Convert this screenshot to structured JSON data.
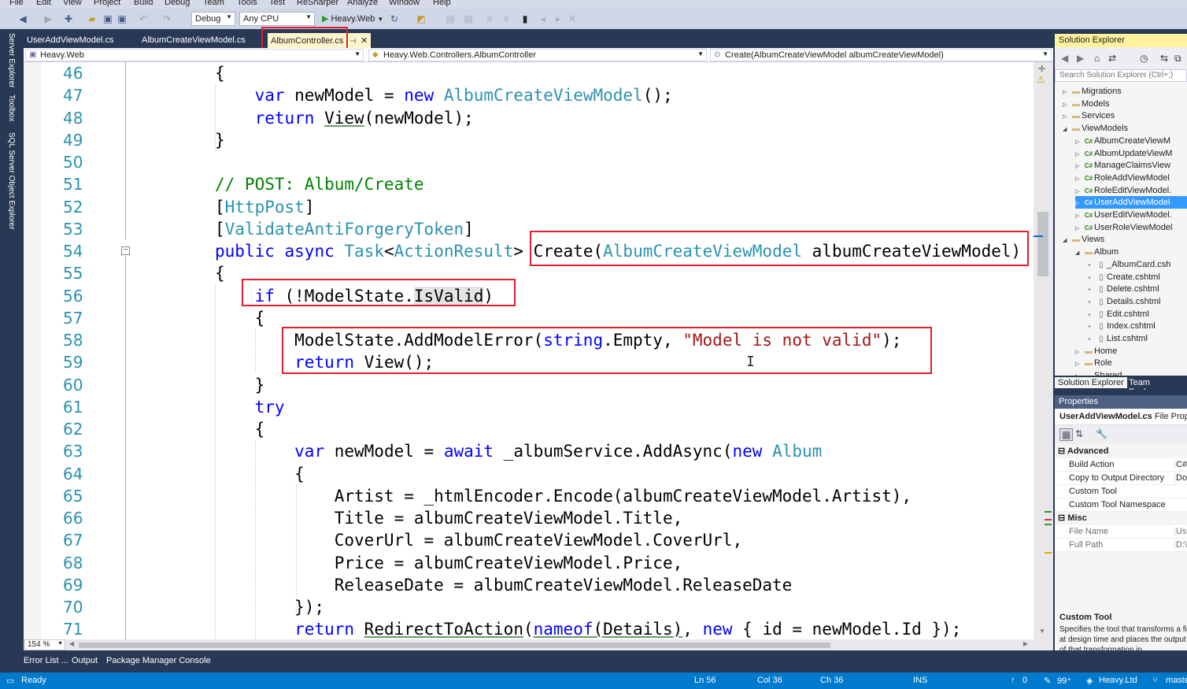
{
  "menu": [
    "File",
    "Edit",
    "View",
    "Project",
    "Build",
    "Debug",
    "Team",
    "Tools",
    "Test",
    "ReSharper",
    "Analyze",
    "Window",
    "Help"
  ],
  "toolbar": {
    "config": "Debug",
    "platform": "Any CPU",
    "run_target": "Heavy.Web"
  },
  "side_tabs": [
    "Server Explorer",
    "Toolbox",
    "SQL Server Object Explorer"
  ],
  "doc_tabs": [
    {
      "label": "UserAddViewModel.cs",
      "active": false
    },
    {
      "label": "AlbumCreateViewModel.cs",
      "active": false
    },
    {
      "label": "AlbumController.cs",
      "active": true
    }
  ],
  "navbar": {
    "project": "Heavy.Web",
    "type": "Heavy.Web.Controllers.AlbumController",
    "member": "Create(AlbumCreateViewModel albumCreateViewModel)"
  },
  "code_lines": [
    {
      "n": "46",
      "html": "    {"
    },
    {
      "n": "47",
      "html": "        <span class=\"k\">var</span> newModel = <span class=\"k\">new</span> <span class=\"t\">AlbumCreateViewModel</span>();"
    },
    {
      "n": "48",
      "html": "        <span class=\"k\">return</span> <span class=\"ul\">View</span>(newModel);"
    },
    {
      "n": "49",
      "html": "    }"
    },
    {
      "n": "50",
      "html": ""
    },
    {
      "n": "51",
      "html": "    <span class=\"c\">// POST: Album/Create</span>"
    },
    {
      "n": "52",
      "html": "    [<span class=\"t\">HttpPost</span>]"
    },
    {
      "n": "53",
      "html": "    [<span class=\"t\">ValidateAntiForgeryToken</span>]"
    },
    {
      "n": "54",
      "html": "    <span class=\"k\">public</span> <span class=\"k\">async</span> <span class=\"t\">Task</span>&lt;<span class=\"t\">ActionResult</span>&gt; Create(<span class=\"t\">AlbumCreateViewModel</span> albumCreateViewModel)"
    },
    {
      "n": "55",
      "html": "    {"
    },
    {
      "n": "56",
      "html": "        <span class=\"k\">if</span> (!ModelState.<span class=\"hl\">IsValid</span>)"
    },
    {
      "n": "57",
      "html": "        {"
    },
    {
      "n": "58",
      "html": "            ModelState.AddModelError(<span class=\"k\">string</span>.Empty, <span class=\"s\">\"Model is not valid\"</span>);"
    },
    {
      "n": "59",
      "html": "            <span class=\"k\">return</span> View();"
    },
    {
      "n": "60",
      "html": "        }"
    },
    {
      "n": "61",
      "html": "        <span class=\"k\">try</span>"
    },
    {
      "n": "62",
      "html": "        {"
    },
    {
      "n": "63",
      "html": "            <span class=\"k\">var</span> newModel = <span class=\"k\">await</span> _albumService.AddAsync(<span class=\"k\">new</span> <span class=\"t\">Album</span>"
    },
    {
      "n": "64",
      "html": "            {"
    },
    {
      "n": "65",
      "html": "                Artist = _htmlEncoder.Encode(albumCreateViewModel.Artist),"
    },
    {
      "n": "66",
      "html": "                Title = albumCreateViewModel.Title,"
    },
    {
      "n": "67",
      "html": "                CoverUrl = albumCreateViewModel.CoverUrl,"
    },
    {
      "n": "68",
      "html": "                Price = albumCreateViewModel.Price,"
    },
    {
      "n": "69",
      "html": "                ReleaseDate = albumCreateViewModel.ReleaseDate"
    },
    {
      "n": "70",
      "html": "            });"
    },
    {
      "n": "71",
      "html": "            <span class=\"k\">return</span> <span class=\"ul\">RedirectToAction</span>(<span class=\"ul\"><span class=\"k\">nameof</span>(Details)</span>, <span class=\"k\">new</span> { id = newModel.Id });"
    }
  ],
  "zoom": "154 %",
  "tool_tabs": [
    "Error List ...",
    "Output",
    "Package Manager Console"
  ],
  "status": {
    "ready": "Ready",
    "ln": "Ln 56",
    "col": "Col 36",
    "ch": "Ch 36",
    "ins": "INS",
    "up": "0",
    "pencil": "99⁺",
    "repo": "Heavy.Ltd",
    "branch": "maste"
  },
  "solution_explorer": {
    "title": "Solution Explorer",
    "search_placeholder": "Search Solution Explorer (Ctrl+;)",
    "items": [
      {
        "label": "Migrations",
        "kind": "folder",
        "depth": 1,
        "expanded": false
      },
      {
        "label": "Models",
        "kind": "folder",
        "depth": 1,
        "expanded": false
      },
      {
        "label": "Services",
        "kind": "folder",
        "depth": 1,
        "expanded": false
      },
      {
        "label": "ViewModels",
        "kind": "folder",
        "depth": 1,
        "expanded": true
      },
      {
        "label": "AlbumCreateViewM",
        "kind": "cs",
        "depth": 2
      },
      {
        "label": "AlbumUpdateViewM",
        "kind": "cs",
        "depth": 2
      },
      {
        "label": "ManageClaimsView",
        "kind": "cs",
        "depth": 2
      },
      {
        "label": "RoleAddViewModel",
        "kind": "cs",
        "depth": 2
      },
      {
        "label": "RoleEditViewModel.",
        "kind": "cs",
        "depth": 2
      },
      {
        "label": "UserAddViewModel",
        "kind": "cs",
        "depth": 2,
        "selected": true
      },
      {
        "label": "UserEditViewModel.",
        "kind": "cs",
        "depth": 2
      },
      {
        "label": "UserRoleViewModel",
        "kind": "cs",
        "depth": 2
      },
      {
        "label": "Views",
        "kind": "folder",
        "depth": 1,
        "expanded": true
      },
      {
        "label": "Album",
        "kind": "folder",
        "depth": 2,
        "expanded": true
      },
      {
        "label": "_AlbumCard.csh",
        "kind": "file",
        "depth": 3
      },
      {
        "label": "Create.cshtml",
        "kind": "file",
        "depth": 3
      },
      {
        "label": "Delete.cshtml",
        "kind": "file",
        "depth": 3
      },
      {
        "label": "Details.cshtml",
        "kind": "file",
        "depth": 3
      },
      {
        "label": "Edit.cshtml",
        "kind": "file",
        "depth": 3
      },
      {
        "label": "Index.cshtml",
        "kind": "file",
        "depth": 3
      },
      {
        "label": "List.cshtml",
        "kind": "file",
        "depth": 3
      },
      {
        "label": "Home",
        "kind": "folder",
        "depth": 2,
        "expanded": false
      },
      {
        "label": "Role",
        "kind": "folder",
        "depth": 2,
        "expanded": false
      },
      {
        "label": "Shared",
        "kind": "folder",
        "depth": 2,
        "expanded": false
      }
    ],
    "bottom_tabs": [
      "Solution Explorer",
      "Team Explorer"
    ]
  },
  "properties": {
    "title": "Properties",
    "object_name": "UserAddViewModel.cs",
    "object_type": "File Prope",
    "categories": [
      {
        "name": "Advanced",
        "rows": [
          {
            "name": "Build Action",
            "value": "C#"
          },
          {
            "name": "Copy to Output Directory",
            "value": "Do"
          },
          {
            "name": "Custom Tool",
            "value": ""
          },
          {
            "name": "Custom Tool Namespace",
            "value": ""
          }
        ]
      },
      {
        "name": "Misc",
        "rows": [
          {
            "name": "File Name",
            "value": "Use"
          },
          {
            "name": "Full Path",
            "value": "D:\\"
          }
        ]
      }
    ],
    "desc_title": "Custom Tool",
    "desc_text": "Specifies the tool that transforms a file at design time and places the output of that transformation in"
  },
  "colors": {
    "accent": "#007acc",
    "highlight_box": "#e0202c",
    "keyword": "#0000ff",
    "type": "#2b91af",
    "comment": "#008000",
    "string": "#a31515"
  }
}
